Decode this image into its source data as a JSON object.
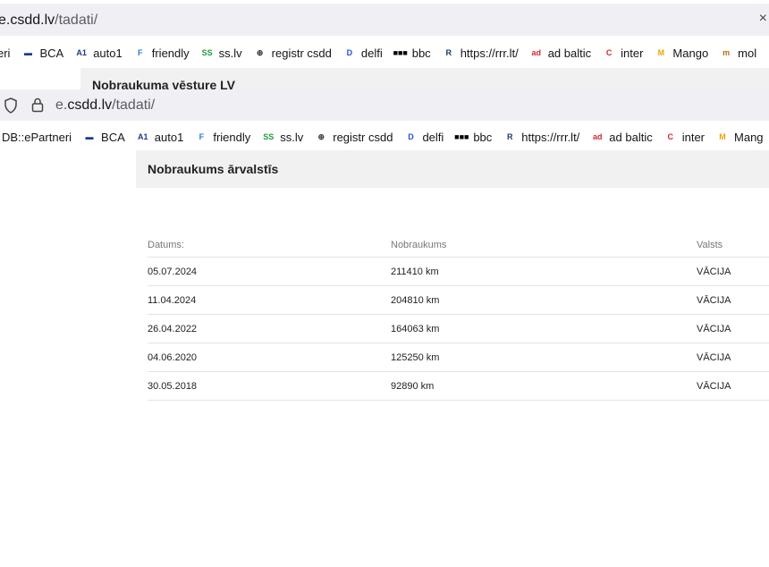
{
  "back_window": {
    "url_prefix": "e.",
    "url_domain": "csdd.lv",
    "url_path": "/tadati/",
    "close_glyph": "×",
    "bookmarks": [
      {
        "label": "eri",
        "icon": ""
      },
      {
        "label": "BCA",
        "icon": "bca-icon"
      },
      {
        "label": "auto1",
        "icon": "auto1-icon"
      },
      {
        "label": "friendly",
        "icon": "friendly-icon"
      },
      {
        "label": "ss.lv",
        "icon": "ss-icon"
      },
      {
        "label": "registr csdd",
        "icon": "globe-icon"
      },
      {
        "label": "delfi",
        "icon": "delfi-icon"
      },
      {
        "label": "bbc",
        "icon": "bbc-icon"
      },
      {
        "label": "https://rrr.lt/",
        "icon": "rrr-icon"
      },
      {
        "label": "ad baltic",
        "icon": "adbaltic-icon"
      },
      {
        "label": "inter",
        "icon": "inter-icon"
      },
      {
        "label": "Mango",
        "icon": "mango-icon"
      },
      {
        "label": "mol",
        "icon": "mobile-icon"
      }
    ],
    "page_title": "Nobraukuma vēsture LV"
  },
  "front_window": {
    "url_domain_prefix": "e.",
    "url_domain": "csdd.lv",
    "url_path": "/tadati/",
    "bookmarks": [
      {
        "label": "DB::ePartneri",
        "icon": ""
      },
      {
        "label": "BCA",
        "icon": "bca-icon"
      },
      {
        "label": "auto1",
        "icon": "auto1-icon"
      },
      {
        "label": "friendly",
        "icon": "friendly-icon"
      },
      {
        "label": "ss.lv",
        "icon": "ss-icon"
      },
      {
        "label": "registr csdd",
        "icon": "globe-icon"
      },
      {
        "label": "delfi",
        "icon": "delfi-icon"
      },
      {
        "label": "bbc",
        "icon": "bbc-icon"
      },
      {
        "label": "https://rrr.lt/",
        "icon": "rrr-icon"
      },
      {
        "label": "ad baltic",
        "icon": "adbaltic-icon"
      },
      {
        "label": "inter",
        "icon": "inter-icon"
      },
      {
        "label": "Mang",
        "icon": "mango-icon"
      }
    ],
    "page_title": "Nobraukums ārvalstīs",
    "table": {
      "headers": [
        "Datums:",
        "Nobraukums",
        "Valsts"
      ],
      "rows": [
        [
          "05.07.2024",
          "211410 km",
          "VĀCIJA"
        ],
        [
          "11.04.2024",
          "204810 km",
          "VĀCIJA"
        ],
        [
          "26.04.2022",
          "164063 km",
          "VĀCIJA"
        ],
        [
          "04.06.2020",
          "125250 km",
          "VĀCIJA"
        ],
        [
          "30.05.2018",
          "92890 km",
          "VĀCIJA"
        ]
      ]
    }
  },
  "icon_glyphs": {
    "bca-icon": "▬",
    "auto1-icon": "A1",
    "friendly-icon": "F",
    "ss-icon": "SS",
    "globe-icon": "⊕",
    "delfi-icon": "D",
    "bbc-icon": "■■■",
    "rrr-icon": "R",
    "adbaltic-icon": "ad",
    "inter-icon": "C",
    "mango-icon": "M",
    "mobile-icon": "m"
  },
  "icon_colors": {
    "bca-icon": "#1b3a8c",
    "auto1-icon": "#1b3a8c",
    "friendly-icon": "#2c7bd6",
    "ss-icon": "#1f9a3c",
    "globe-icon": "#333333",
    "delfi-icon": "#2352d6",
    "bbc-icon": "#000000",
    "rrr-icon": "#1c3a6b",
    "adbaltic-icon": "#d0282e",
    "inter-icon": "#d0282e",
    "mango-icon": "#f0a300",
    "mobile-icon": "#c06a00"
  }
}
